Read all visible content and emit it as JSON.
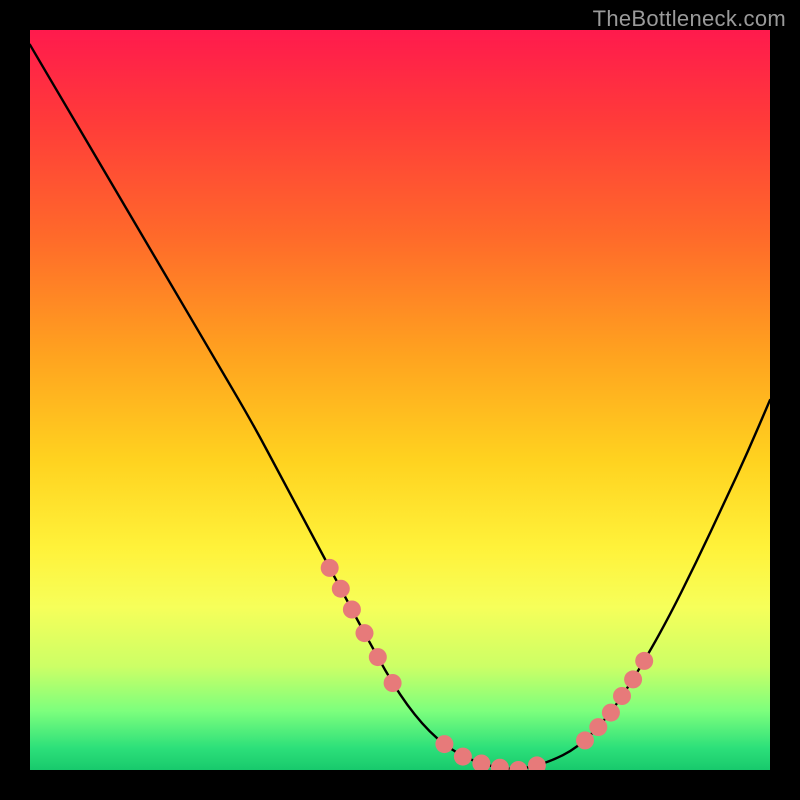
{
  "watermark": "TheBottleneck.com",
  "chart_data": {
    "type": "line",
    "title": "",
    "xlabel": "",
    "ylabel": "",
    "xlim": [
      0,
      1
    ],
    "ylim": [
      0,
      1
    ],
    "series": [
      {
        "name": "curve",
        "x": [
          0.0,
          0.05,
          0.1,
          0.15,
          0.2,
          0.25,
          0.3,
          0.34,
          0.38,
          0.42,
          0.46,
          0.5,
          0.54,
          0.58,
          0.62,
          0.66,
          0.7,
          0.74,
          0.78,
          0.82,
          0.86,
          0.9,
          0.94,
          0.97,
          1.0
        ],
        "values": [
          0.98,
          0.895,
          0.81,
          0.725,
          0.64,
          0.555,
          0.47,
          0.395,
          0.32,
          0.245,
          0.17,
          0.1,
          0.05,
          0.02,
          0.005,
          0.0,
          0.01,
          0.03,
          0.07,
          0.13,
          0.2,
          0.28,
          0.365,
          0.43,
          0.5
        ]
      }
    ],
    "markers": {
      "note": "approximate marker positions on the curve (x in data-space)",
      "x_left": [
        0.405,
        0.42,
        0.435,
        0.452,
        0.47,
        0.49
      ],
      "x_floor": [
        0.56,
        0.585,
        0.61,
        0.635,
        0.66,
        0.685
      ],
      "x_right": [
        0.75,
        0.768,
        0.785,
        0.8,
        0.815,
        0.83
      ]
    },
    "colors": {
      "curve": "#000000",
      "markers": "#e77a7a",
      "gradient_top": "#ff1a4d",
      "gradient_bottom": "#18c96c"
    }
  }
}
